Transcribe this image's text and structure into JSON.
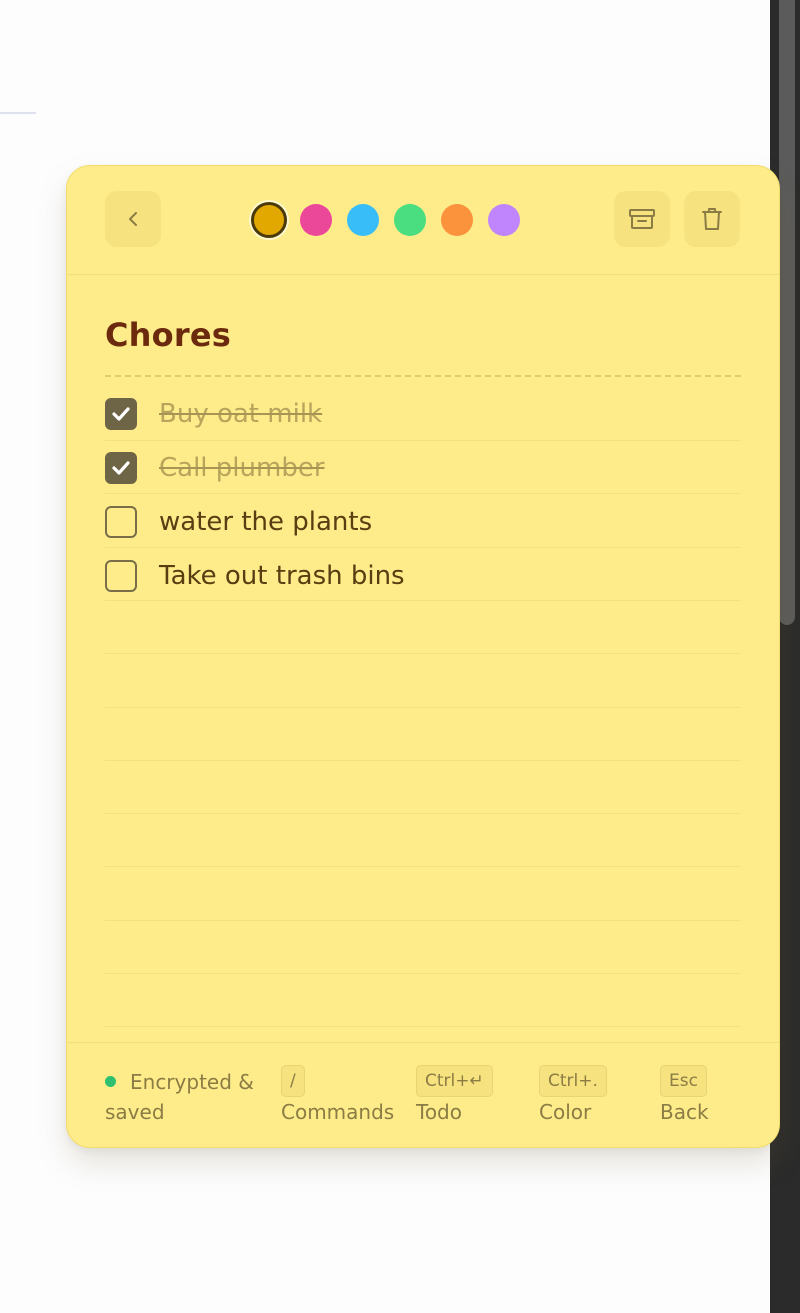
{
  "note": {
    "title": "Chores",
    "colors": [
      {
        "name": "amber",
        "hex": "#e2a800",
        "selected": true
      },
      {
        "name": "pink",
        "hex": "#ec4899",
        "selected": false
      },
      {
        "name": "sky",
        "hex": "#38bdf8",
        "selected": false
      },
      {
        "name": "green",
        "hex": "#4ade80",
        "selected": false
      },
      {
        "name": "orange",
        "hex": "#fb923c",
        "selected": false
      },
      {
        "name": "purple",
        "hex": "#c084fc",
        "selected": false
      }
    ],
    "background_color": "#fdec89",
    "header_icons": {
      "back": "chevron-left-icon",
      "archive": "archive-icon",
      "delete": "trash-icon"
    },
    "todos": [
      {
        "text": "Buy oat milk",
        "done": true
      },
      {
        "text": "Call plumber",
        "done": true
      },
      {
        "text": "water the plants",
        "done": false
      },
      {
        "text": "Take out trash bins",
        "done": false
      }
    ]
  },
  "footer": {
    "status": "Encrypted & saved",
    "status_color": "#2fbf71",
    "shortcuts": [
      {
        "key": "/",
        "label": "Commands"
      },
      {
        "key": "Ctrl+↵",
        "label": "Todo"
      },
      {
        "key": "Ctrl+.",
        "label": "Color"
      },
      {
        "key": "Esc",
        "label": "Back"
      }
    ]
  }
}
